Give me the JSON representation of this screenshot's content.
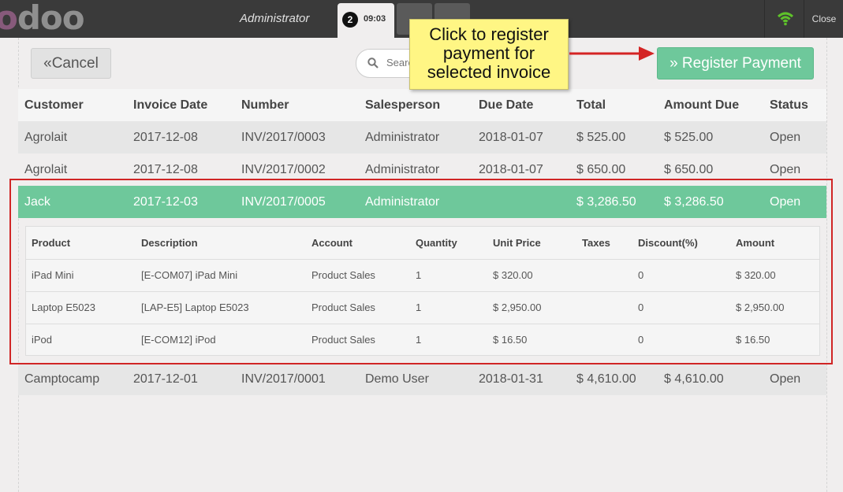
{
  "topbar": {
    "logo_first": "o",
    "logo_rest": "doo",
    "user": "Administrator",
    "order_number": "2",
    "order_time": "09:03",
    "close_label": "Close"
  },
  "toolbar": {
    "cancel_label": "Cancel",
    "search_placeholder": "Search",
    "register_label": "Register Payment"
  },
  "callout": {
    "text_lines": [
      "Click to register",
      "payment for",
      "selected invoice"
    ]
  },
  "invoice_table": {
    "columns": [
      "Customer",
      "Invoice Date",
      "Number",
      "Salesperson",
      "Due Date",
      "Total",
      "Amount Due",
      "Status"
    ],
    "rows": [
      [
        "Agrolait",
        "2017-12-08",
        "INV/2017/0003",
        "Administrator",
        "2018-01-07",
        "$ 525.00",
        "$ 525.00",
        "Open"
      ],
      [
        "Agrolait",
        "2017-12-08",
        "INV/2017/0002",
        "Administrator",
        "2018-01-07",
        "$ 650.00",
        "$ 650.00",
        "Open"
      ],
      [
        "Jack",
        "2017-12-03",
        "INV/2017/0005",
        "Administrator",
        "",
        "$ 3,286.50",
        "$ 3,286.50",
        "Open"
      ],
      [
        "Camptocamp",
        "2017-12-01",
        "INV/2017/0001",
        "Demo User",
        "2018-01-31",
        "$ 4,610.00",
        "$ 4,610.00",
        "Open"
      ]
    ],
    "selected_row": 2
  },
  "invoice_lines": {
    "columns": [
      "Product",
      "Description",
      "Account",
      "Quantity",
      "Unit Price",
      "Taxes",
      "Discount(%)",
      "Amount"
    ],
    "rows": [
      [
        "iPad Mini",
        "[E-COM07] iPad Mini",
        "Product Sales",
        "1",
        "$ 320.00",
        "",
        "0",
        "$ 320.00"
      ],
      [
        "Laptop E5023",
        "[LAP-E5] Laptop E5023",
        "Product Sales",
        "1",
        "$ 2,950.00",
        "",
        "0",
        "$ 2,950.00"
      ],
      [
        "iPod",
        "[E-COM12] iPod",
        "Product Sales",
        "1",
        "$ 16.50",
        "",
        "0",
        "$ 16.50"
      ]
    ]
  },
  "colors": {
    "accent_green": "#6ec89b",
    "topbar": "#3a3a3a",
    "callout_yellow": "#fff684",
    "highlight_red": "#d02525"
  },
  "icons": [
    "angle-double-left-icon",
    "search-icon",
    "angle-double-right-icon",
    "wifi-icon"
  ]
}
